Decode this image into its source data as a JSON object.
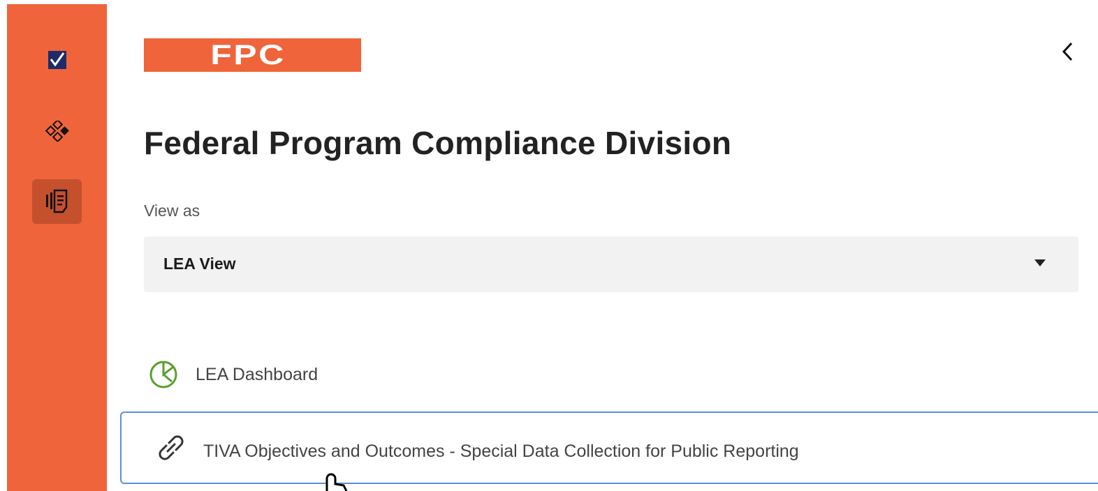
{
  "sidebar": {
    "background_color": "#EF643A",
    "icons": [
      {
        "name": "checkbox-icon",
        "active": false
      },
      {
        "name": "modules-icon",
        "active": false
      },
      {
        "name": "document-list-icon",
        "active": true
      }
    ]
  },
  "header": {
    "logo_text": "FPC",
    "logo_color": "#EF643A",
    "collapse_icon": "chevron-left-icon"
  },
  "main": {
    "title": "Federal Program Compliance Division",
    "view_as_label": "View as",
    "view_select": {
      "selected": "LEA View",
      "caret_icon": "caret-down-icon"
    },
    "nav_items": [
      {
        "label": "LEA Dashboard",
        "icon": "pie-chart-icon",
        "icon_color": "#5A9E2F"
      },
      {
        "label": "TIVA Objectives and Outcomes - Special Data Collection for Public Reporting",
        "icon": "link-icon",
        "focused": true,
        "focus_border_color": "#5B8FD6"
      }
    ]
  }
}
